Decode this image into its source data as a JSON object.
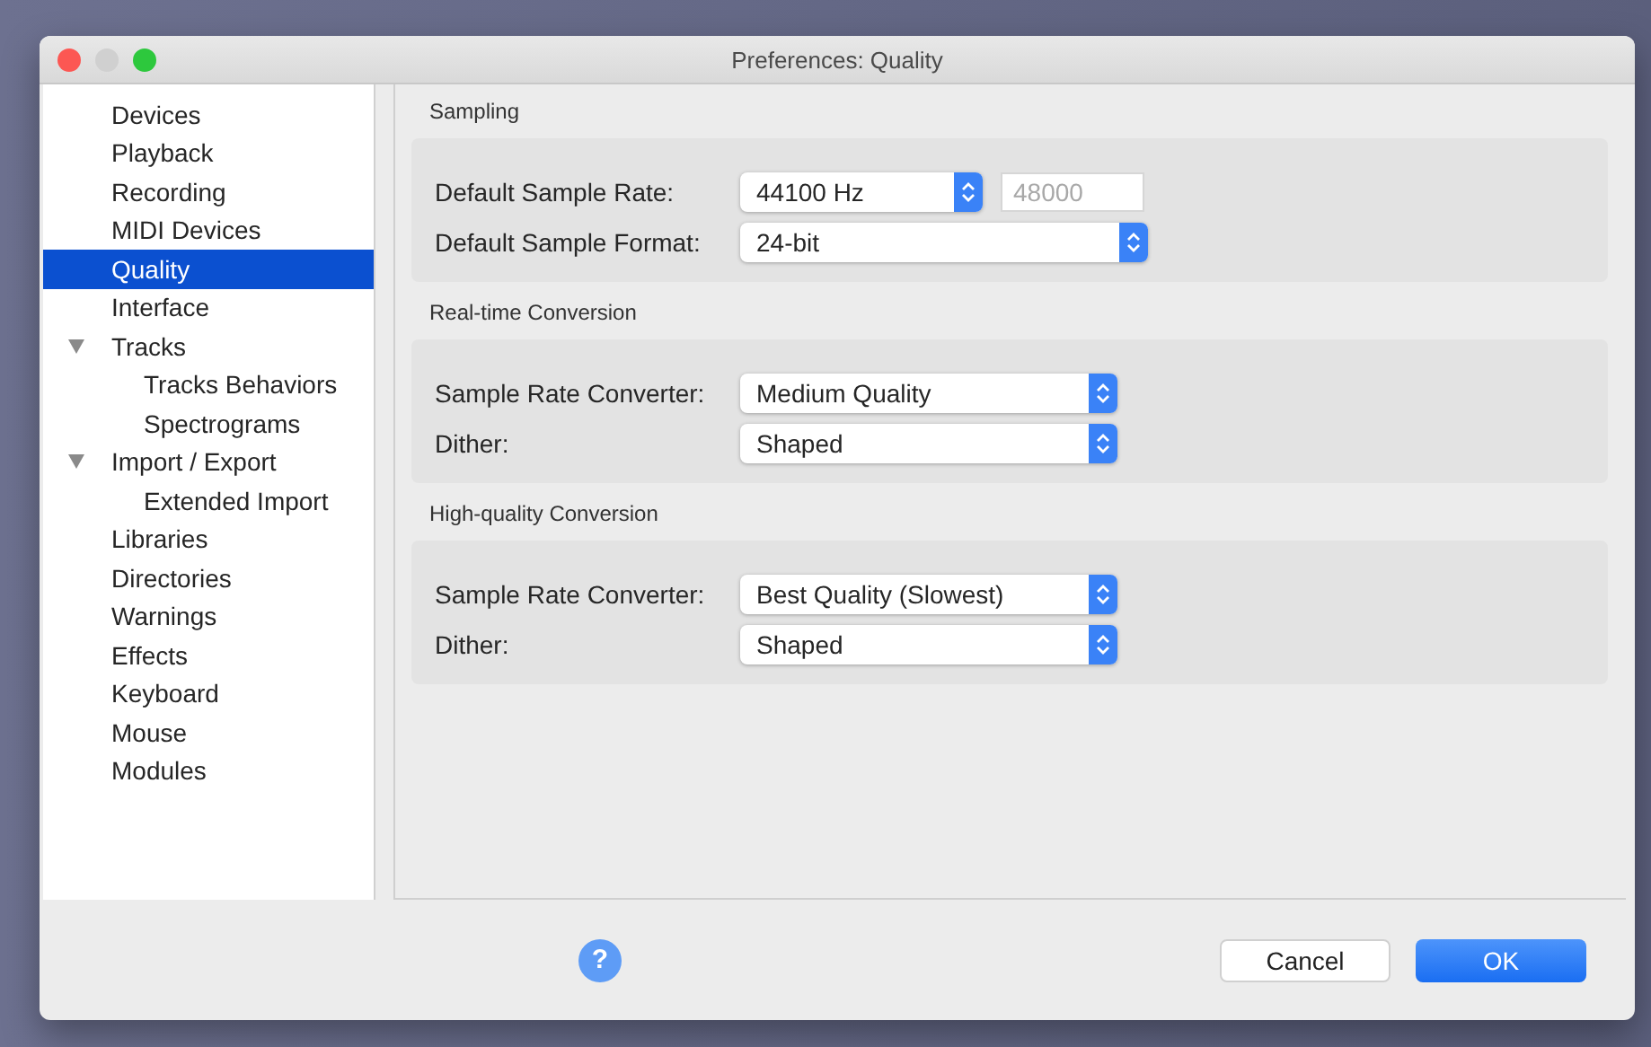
{
  "window": {
    "title": "Preferences: Quality"
  },
  "sidebar": {
    "items": [
      {
        "label": "Devices",
        "selected": false
      },
      {
        "label": "Playback",
        "selected": false
      },
      {
        "label": "Recording",
        "selected": false
      },
      {
        "label": "MIDI Devices",
        "selected": false
      },
      {
        "label": "Quality",
        "selected": true
      },
      {
        "label": "Interface",
        "selected": false
      },
      {
        "label": "Tracks",
        "selected": false,
        "expanded": true,
        "children": [
          {
            "label": "Tracks Behaviors",
            "selected": false
          },
          {
            "label": "Spectrograms",
            "selected": false
          }
        ]
      },
      {
        "label": "Import / Export",
        "selected": false,
        "expanded": true,
        "children": [
          {
            "label": "Extended Import",
            "selected": false
          }
        ]
      },
      {
        "label": "Libraries",
        "selected": false
      },
      {
        "label": "Directories",
        "selected": false
      },
      {
        "label": "Warnings",
        "selected": false
      },
      {
        "label": "Effects",
        "selected": false
      },
      {
        "label": "Keyboard",
        "selected": false
      },
      {
        "label": "Mouse",
        "selected": false
      },
      {
        "label": "Modules",
        "selected": false
      }
    ]
  },
  "sections": [
    {
      "title": "Sampling",
      "rows": [
        {
          "label": "Default Sample Rate:",
          "value": "44100 Hz",
          "custom_field": {
            "value": "48000",
            "disabled": true
          }
        },
        {
          "label": "Default Sample Format:",
          "value": "24-bit"
        }
      ]
    },
    {
      "title": "Real-time Conversion",
      "rows": [
        {
          "label": "Sample Rate Converter:",
          "value": "Medium Quality"
        },
        {
          "label": "Dither:",
          "value": "Shaped"
        }
      ]
    },
    {
      "title": "High-quality Conversion",
      "rows": [
        {
          "label": "Sample Rate Converter:",
          "value": "Best Quality (Slowest)"
        },
        {
          "label": "Dither:",
          "value": "Shaped"
        }
      ]
    }
  ],
  "footer": {
    "help_button": "?",
    "buttons": [
      {
        "label": "Cancel",
        "kind": "secondary"
      },
      {
        "label": "OK",
        "kind": "primary"
      }
    ]
  }
}
